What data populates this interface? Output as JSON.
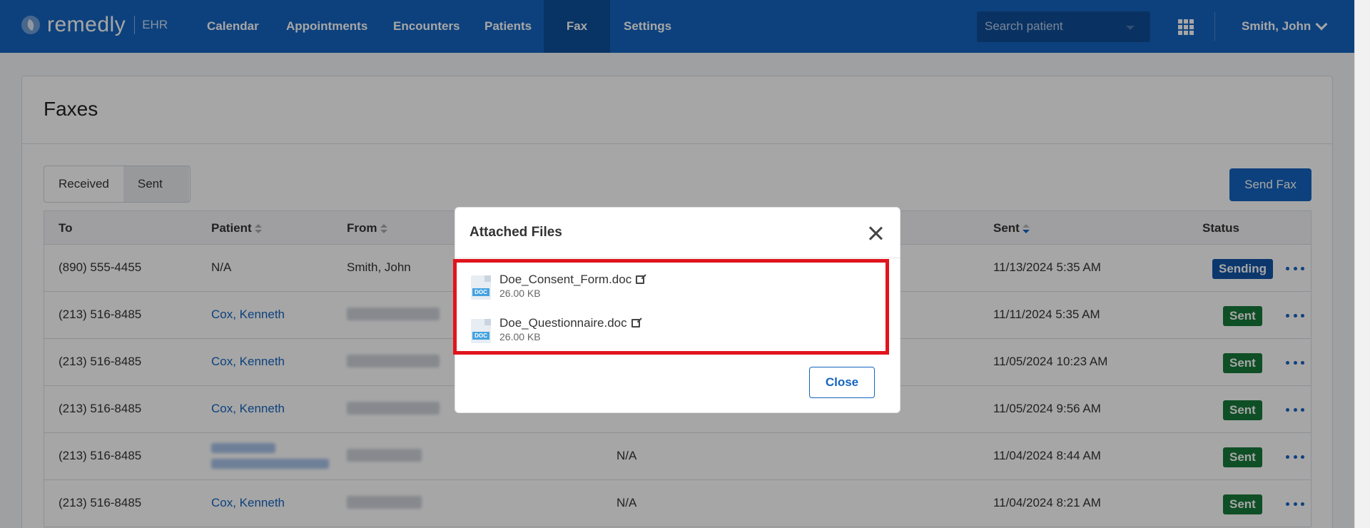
{
  "nav": {
    "logo_name": "remedly",
    "logo_suffix": "EHR",
    "items": [
      {
        "label": "Calendar"
      },
      {
        "label": "Appointments"
      },
      {
        "label": "Encounters"
      },
      {
        "label": "Patients"
      },
      {
        "label": "Fax"
      },
      {
        "label": "Settings"
      }
    ],
    "active": "Fax",
    "search_placeholder": "Search patient",
    "user": "Smith, John"
  },
  "page": {
    "title": "Faxes",
    "tabs": [
      {
        "label": "Received"
      },
      {
        "label": "Sent"
      }
    ],
    "selected_tab": "Sent",
    "send_button": "Send Fax"
  },
  "table": {
    "headers": {
      "to": "To",
      "patient": "Patient",
      "from": "From",
      "sent": "Sent",
      "status": "Status"
    },
    "rows": [
      {
        "to": "(890) 555-4455",
        "patient": "N/A",
        "patient_link": false,
        "from": "Smith, John",
        "pages": "",
        "sent": "11/13/2024 5:35 AM",
        "status": "Sending"
      },
      {
        "to": "(213) 516-8485",
        "patient": "Cox, Kenneth",
        "patient_link": true,
        "from": "",
        "pages": "",
        "sent": "11/11/2024 5:35 AM",
        "status": "Sent"
      },
      {
        "to": "(213) 516-8485",
        "patient": "Cox, Kenneth",
        "patient_link": true,
        "from": "",
        "pages": "",
        "sent": "11/05/2024 10:23 AM",
        "status": "Sent"
      },
      {
        "to": "(213) 516-8485",
        "patient": "Cox, Kenneth",
        "patient_link": true,
        "from": "",
        "pages": "",
        "sent": "11/05/2024 9:56 AM",
        "status": "Sent"
      },
      {
        "to": "(213) 516-8485",
        "patient": "",
        "patient_link": true,
        "from": "",
        "pages": "N/A",
        "sent": "11/04/2024 8:44 AM",
        "status": "Sent"
      },
      {
        "to": "(213) 516-8485",
        "patient": "Cox, Kenneth",
        "patient_link": true,
        "from": "",
        "pages": "N/A",
        "sent": "11/04/2024 8:21 AM",
        "status": "Sent"
      }
    ]
  },
  "modal": {
    "title": "Attached Files",
    "files": [
      {
        "name": "Doe_Consent_Form.doc",
        "size": "26.00 KB",
        "type": "DOC"
      },
      {
        "name": "Doe_Questionnaire.doc",
        "size": "26.00 KB",
        "type": "DOC"
      }
    ],
    "close_label": "Close"
  },
  "colors": {
    "brand": "#1565c0",
    "highlight": "#e0141c",
    "sent_badge": "#187a3b",
    "sending_badge": "#1255a8"
  }
}
